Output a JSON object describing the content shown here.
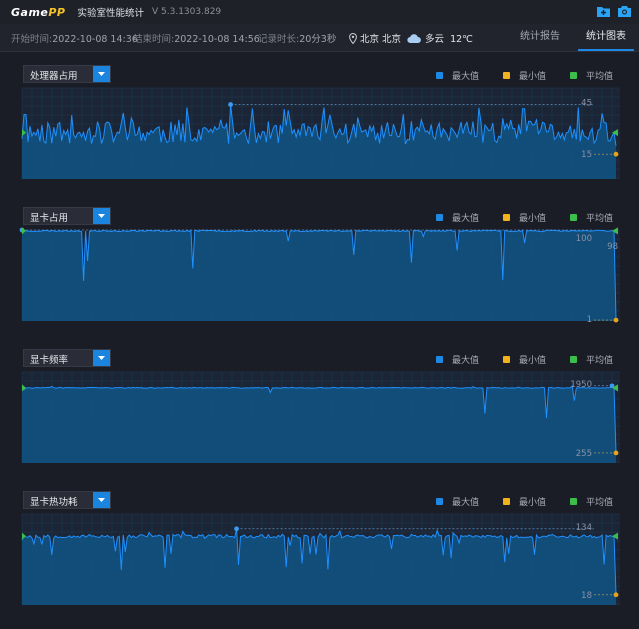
{
  "app": {
    "logo_game": "Game",
    "logo_pp": "PP",
    "title": "实验室性能统计",
    "version": "V 5.3.1303.829"
  },
  "info": {
    "start_label": "开始时间:",
    "start_value": "2022-10-08 14:36",
    "end_label": "结束时间:",
    "end_value": "2022-10-08 14:56",
    "duration_label": "记录时长:",
    "duration_value": "20分3秒",
    "location": "北京 北京",
    "weather": "多云",
    "temperature": "12℃"
  },
  "tabs": [
    {
      "label": "统计报告",
      "active": false
    },
    {
      "label": "统计图表",
      "active": true
    }
  ],
  "legend": {
    "max_label": "最大值",
    "min_label": "最小值",
    "avg_label": "平均值",
    "max_color": "#1e88e5",
    "min_color": "#f2b21b",
    "avg_color": "#3cbe4b"
  },
  "colors": {
    "line": "#1e90ff",
    "fill": "#0f5b93",
    "avg_marker": "#3cbe4b",
    "min_marker": "#e6a419",
    "max_marker": "#3b9bf0",
    "grid": "#1a3a55"
  },
  "chart_data": [
    {
      "type": "line",
      "title": "处理器占用",
      "series_label": "处理器占用",
      "ylim": [
        0,
        55
      ],
      "max": 45,
      "min": 15,
      "avg": 28,
      "baseline": 28,
      "noise": 7,
      "spike_up": 0.15,
      "spike_down": 0.05,
      "max_at": 0.35,
      "end_drop": 20,
      "seed": 11
    },
    {
      "type": "line",
      "title": "显卡占用",
      "series_label": "显卡占用",
      "ylim": [
        0,
        100
      ],
      "max": 100,
      "min": 1,
      "avg": 99,
      "mid_label": "98",
      "baseline": 99,
      "noise": 0.8,
      "spike_up": 0.0,
      "spike_down": 0.03,
      "max_at": 0.0,
      "end_drop": 1,
      "seed": 23
    },
    {
      "type": "line",
      "title": "显卡频率",
      "series_label": "显卡频率",
      "ylim": [
        0,
        2300
      ],
      "max": 1950,
      "min": 255,
      "avg": 1900,
      "baseline": 1900,
      "noise": 10,
      "spike_up": 0.02,
      "spike_down": 0.02,
      "max_at": 1.0,
      "end_drop": 255,
      "seed": 37
    },
    {
      "type": "line",
      "title": "显卡热功耗",
      "series_label": "显卡热功耗",
      "ylim": [
        0,
        160
      ],
      "max": 134,
      "min": 18,
      "avg": 121,
      "baseline": 121,
      "noise": 3,
      "spike_up": 0.04,
      "spike_down": 0.07,
      "max_at": 0.36,
      "end_drop": 18,
      "seed": 53
    }
  ]
}
